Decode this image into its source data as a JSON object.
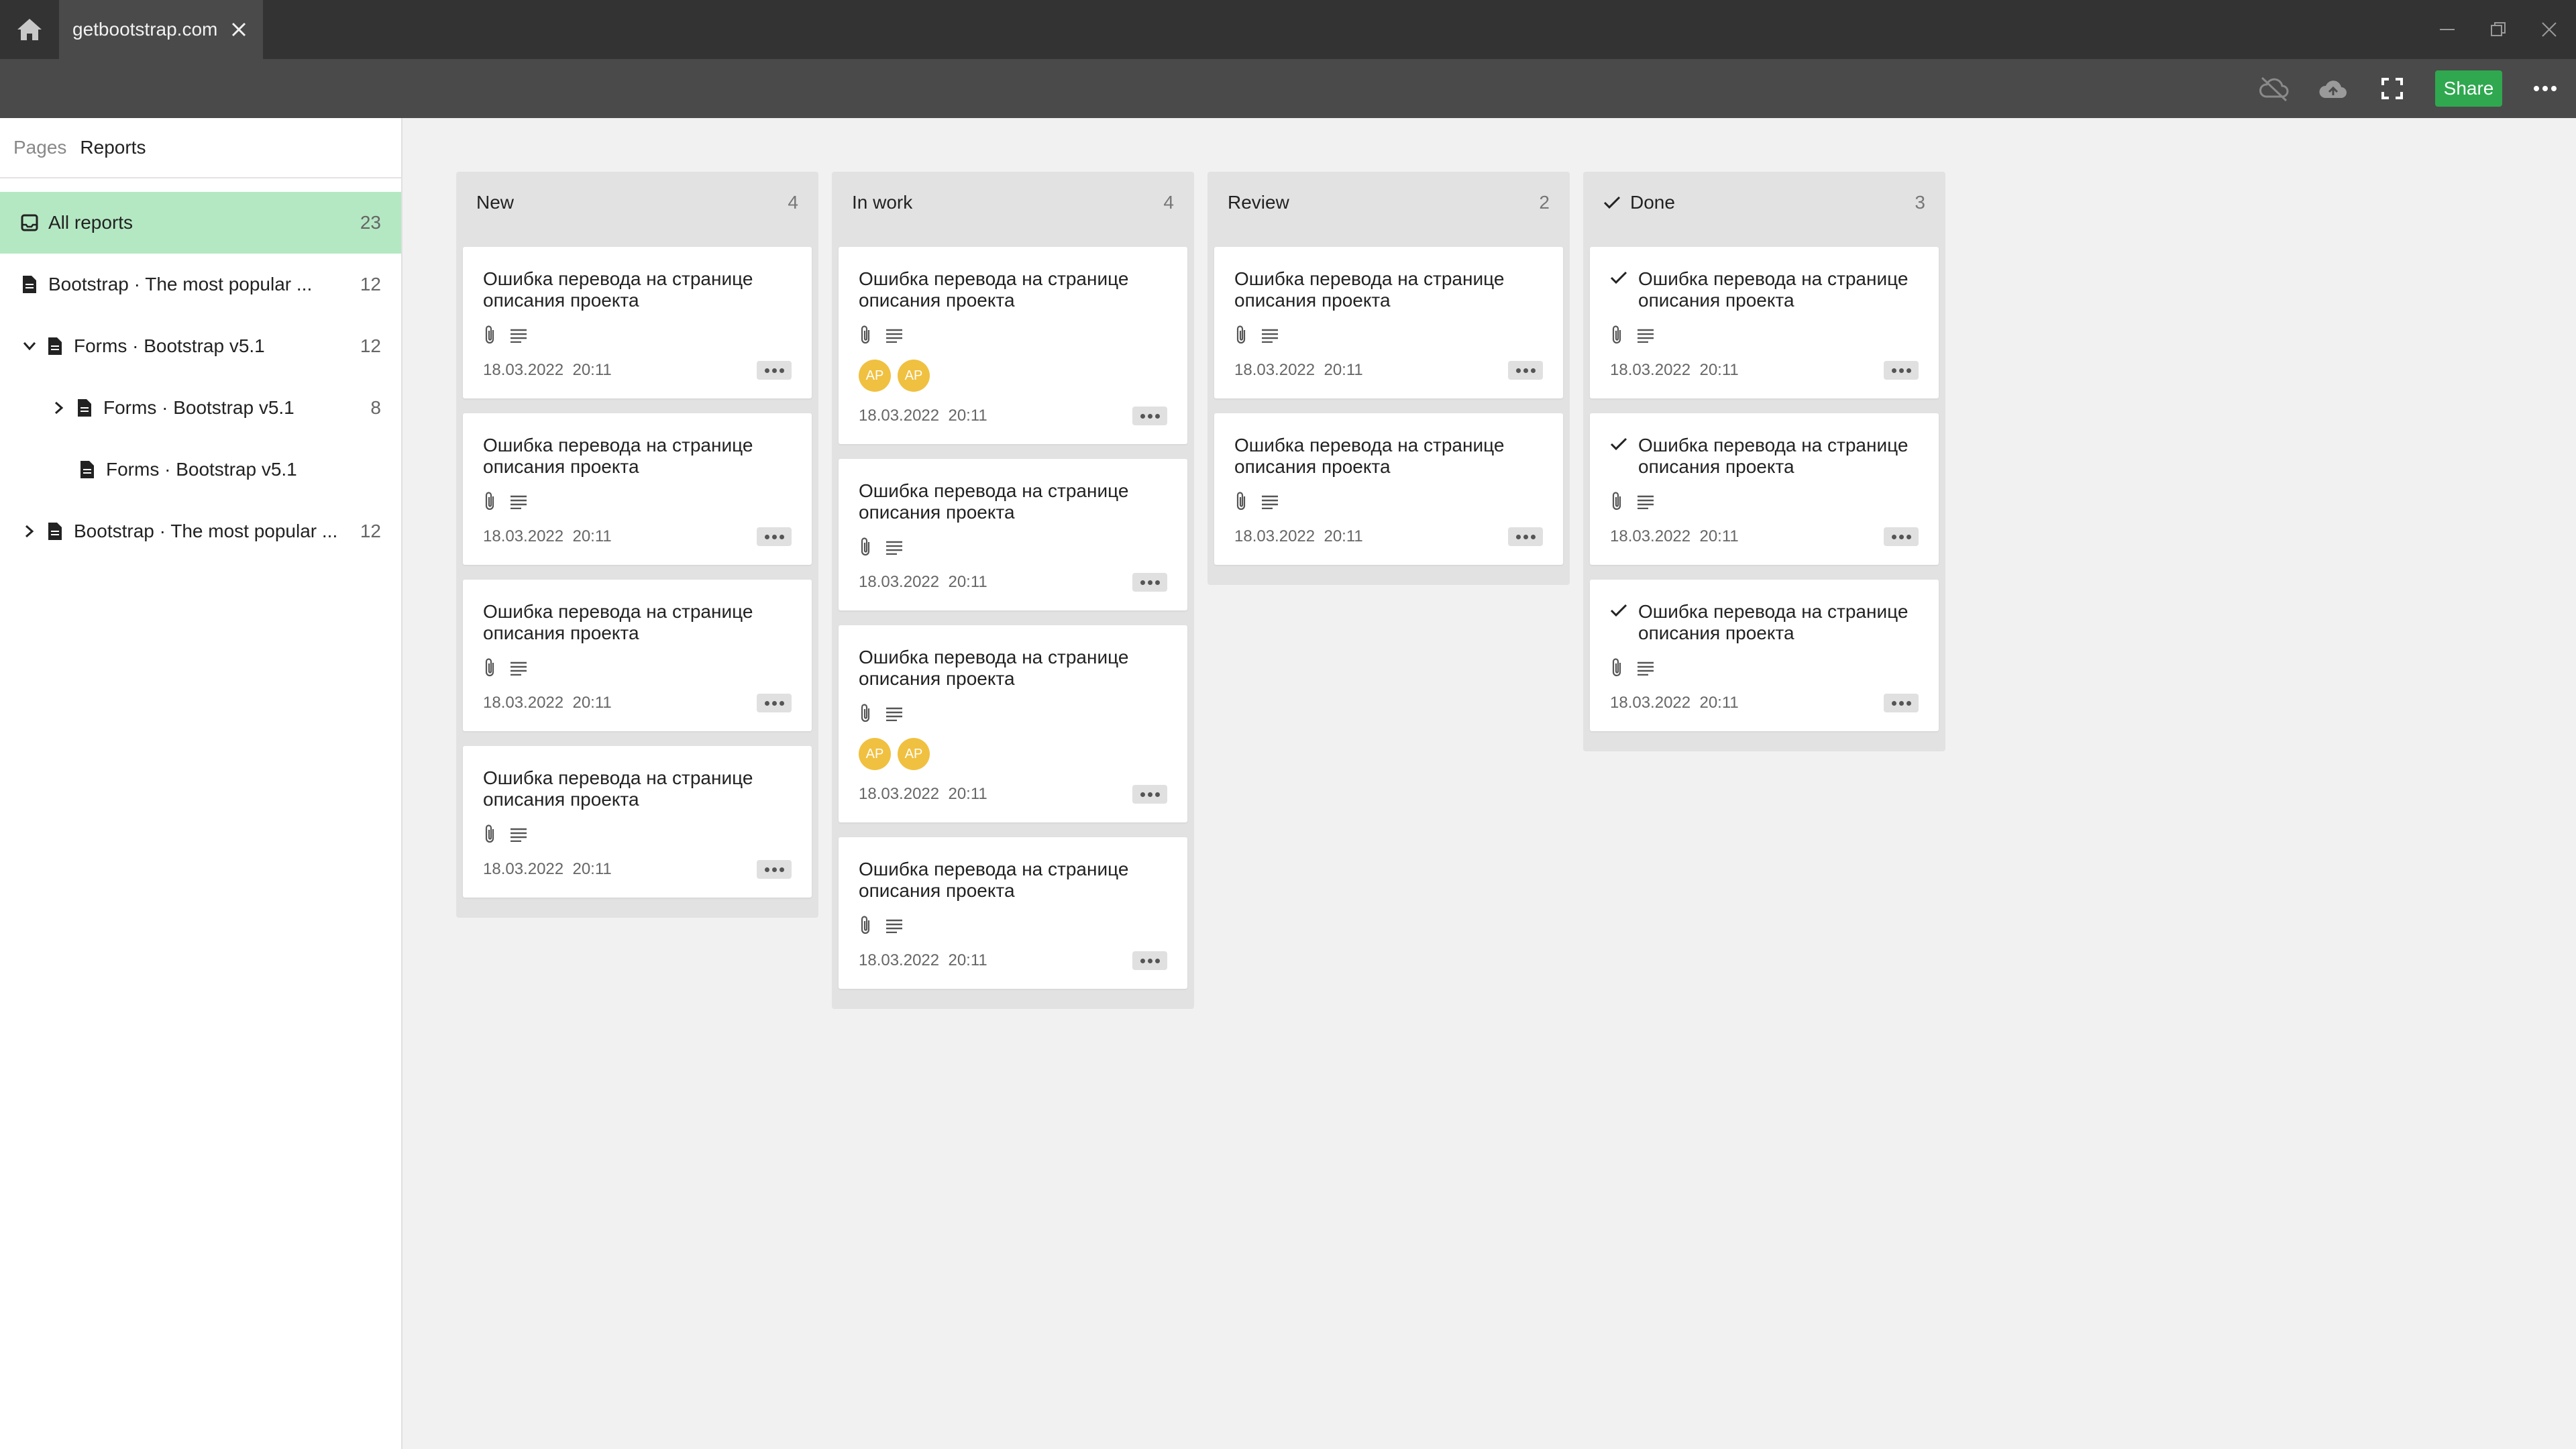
{
  "browser": {
    "tab_title": "getbootstrap.com"
  },
  "toolbar": {
    "share_label": "Share"
  },
  "sidebar": {
    "tabs": [
      "Pages",
      "Reports"
    ],
    "items": [
      {
        "label": "All reports",
        "count": "23"
      },
      {
        "label": "Bootstrap · The most popular ...",
        "count": "12"
      },
      {
        "label": "Forms · Bootstrap v5.1",
        "count": "12"
      },
      {
        "label": "Forms · Bootstrap v5.1",
        "count": "8"
      },
      {
        "label": "Forms · Bootstrap v5.1",
        "count": ""
      },
      {
        "label": "Bootstrap · The most popular ...",
        "count": "12"
      }
    ]
  },
  "board": {
    "columns": [
      {
        "name": "New",
        "count": "4",
        "cards": [
          {
            "title": "Ошибка перевода на странице описания проекта",
            "date": "18.03.2022",
            "time": "20:11"
          },
          {
            "title": "Ошибка перевода на странице описания проекта",
            "date": "18.03.2022",
            "time": "20:11"
          },
          {
            "title": "Ошибка перевода на странице описания проекта",
            "date": "18.03.2022",
            "time": "20:11"
          },
          {
            "title": "Ошибка перевода на странице описания проекта",
            "date": "18.03.2022",
            "time": "20:11"
          }
        ]
      },
      {
        "name": "In work",
        "count": "4",
        "cards": [
          {
            "title": "Ошибка перевода на странице описания проекта",
            "date": "18.03.2022",
            "time": "20:11",
            "avatars": [
              "AP",
              "AP"
            ]
          },
          {
            "title": "Ошибка перевода на странице описания проекта",
            "date": "18.03.2022",
            "time": "20:11"
          },
          {
            "title": "Ошибка перевода на странице описания проекта",
            "date": "18.03.2022",
            "time": "20:11",
            "avatars": [
              "AP",
              "AP"
            ]
          },
          {
            "title": "Ошибка перевода на странице описания проекта",
            "date": "18.03.2022",
            "time": "20:11"
          }
        ]
      },
      {
        "name": "Review",
        "count": "2",
        "cards": [
          {
            "title": "Ошибка перевода на странице описания проекта",
            "date": "18.03.2022",
            "time": "20:11"
          },
          {
            "title": "Ошибка перевода на странице описания проекта",
            "date": "18.03.2022",
            "time": "20:11"
          }
        ]
      },
      {
        "name": "Done",
        "count": "3",
        "cards": [
          {
            "title": "Ошибка перевода на странице описания проекта",
            "date": "18.03.2022",
            "time": "20:11"
          },
          {
            "title": "Ошибка перевода на странице описания проекта",
            "date": "18.03.2022",
            "time": "20:11"
          },
          {
            "title": "Ошибка перевода на странице описания проекта",
            "date": "18.03.2022",
            "time": "20:11"
          }
        ]
      }
    ]
  },
  "colors": {
    "accent_green": "#2fa84f",
    "selected_bg": "#b4e8c3",
    "avatar": "#f0c040"
  }
}
